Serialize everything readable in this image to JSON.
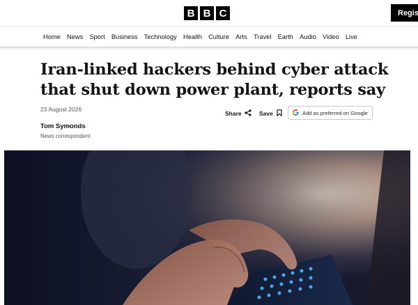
{
  "header": {
    "logo_letters": [
      "B",
      "B",
      "C"
    ],
    "register_label": "Regist"
  },
  "nav": {
    "items": [
      "Home",
      "News",
      "Sport",
      "Business",
      "Technology",
      "Health",
      "Culture",
      "Arts",
      "Travel",
      "Earth",
      "Audio",
      "Video",
      "Live"
    ]
  },
  "article": {
    "headline_line1": "Iran-linked hackers behind cyber attack",
    "headline_line2": "that shut down power plant, reports say",
    "date": "23 August 2026",
    "share_label": "Share",
    "save_label": "Save",
    "google_label": "Add as preferred on Google",
    "author_name": "Tom Symonds",
    "author_role": "News correspondent"
  },
  "hero": {
    "icon": "hands-typing-on-keyboard-photo"
  }
}
